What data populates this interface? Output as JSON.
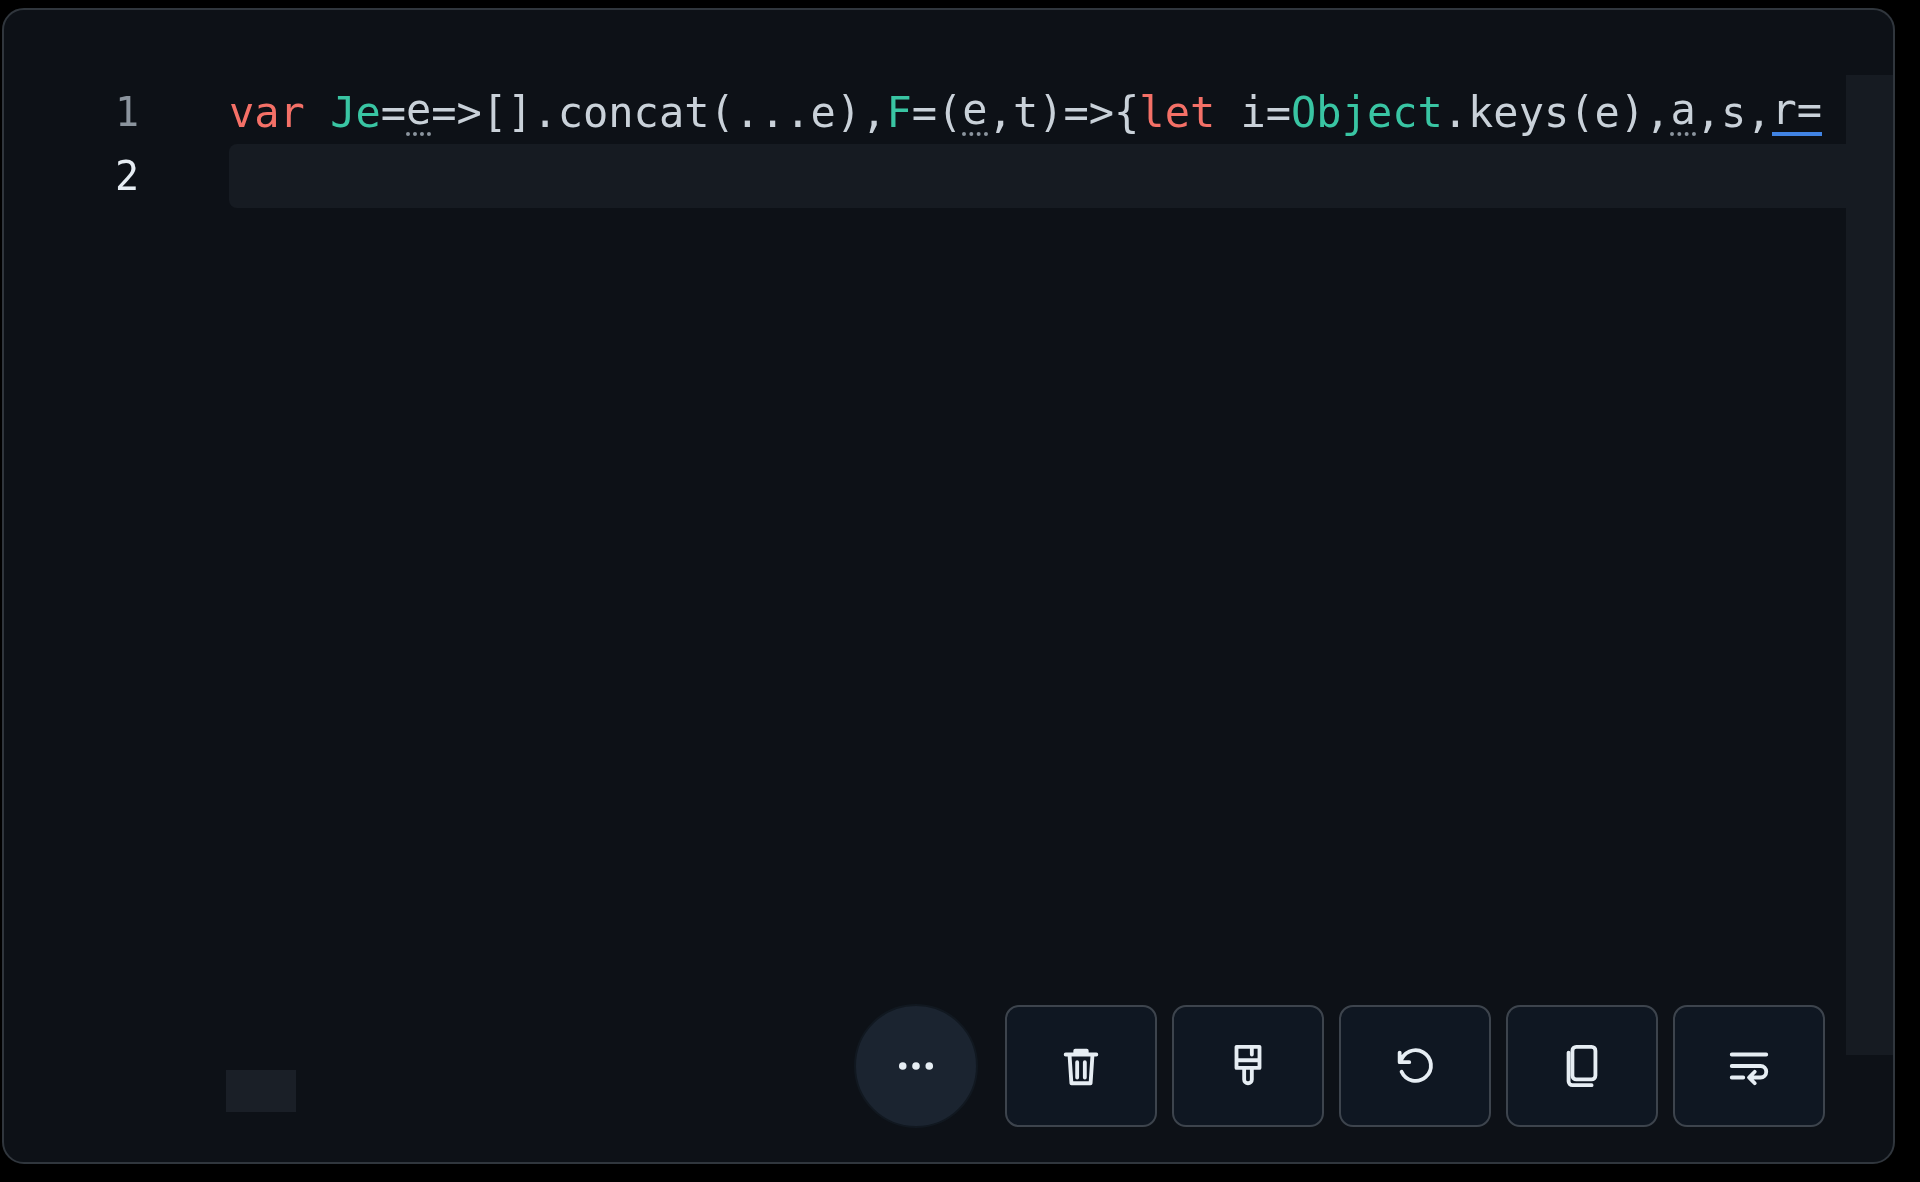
{
  "editor": {
    "lines": [
      {
        "number": "1",
        "current": false,
        "tokens": [
          {
            "text": "var",
            "kind": "keyword"
          },
          {
            "text": " Je",
            "kind": "name"
          },
          {
            "text": "=",
            "kind": "plain"
          },
          {
            "text": "e",
            "kind": "hint"
          },
          {
            "text": "=>[].concat(...e),",
            "kind": "plain"
          },
          {
            "text": "F",
            "kind": "name"
          },
          {
            "text": "=(",
            "kind": "plain"
          },
          {
            "text": "e",
            "kind": "hint"
          },
          {
            "text": ",t)=>{",
            "kind": "plain"
          },
          {
            "text": "let",
            "kind": "keyword"
          },
          {
            "text": " i=",
            "kind": "plain"
          },
          {
            "text": "Object",
            "kind": "name"
          },
          {
            "text": ".keys(e),",
            "kind": "plain"
          },
          {
            "text": "a",
            "kind": "hint"
          },
          {
            "text": ",s,",
            "kind": "plain"
          },
          {
            "text": "r=",
            "kind": "match"
          }
        ]
      },
      {
        "number": "2",
        "current": true
      }
    ]
  },
  "toolbar": [
    {
      "kind": "more"
    },
    {
      "kind": "delete"
    },
    {
      "kind": "format"
    },
    {
      "kind": "reset"
    },
    {
      "kind": "copy"
    },
    {
      "kind": "wrap"
    }
  ]
}
